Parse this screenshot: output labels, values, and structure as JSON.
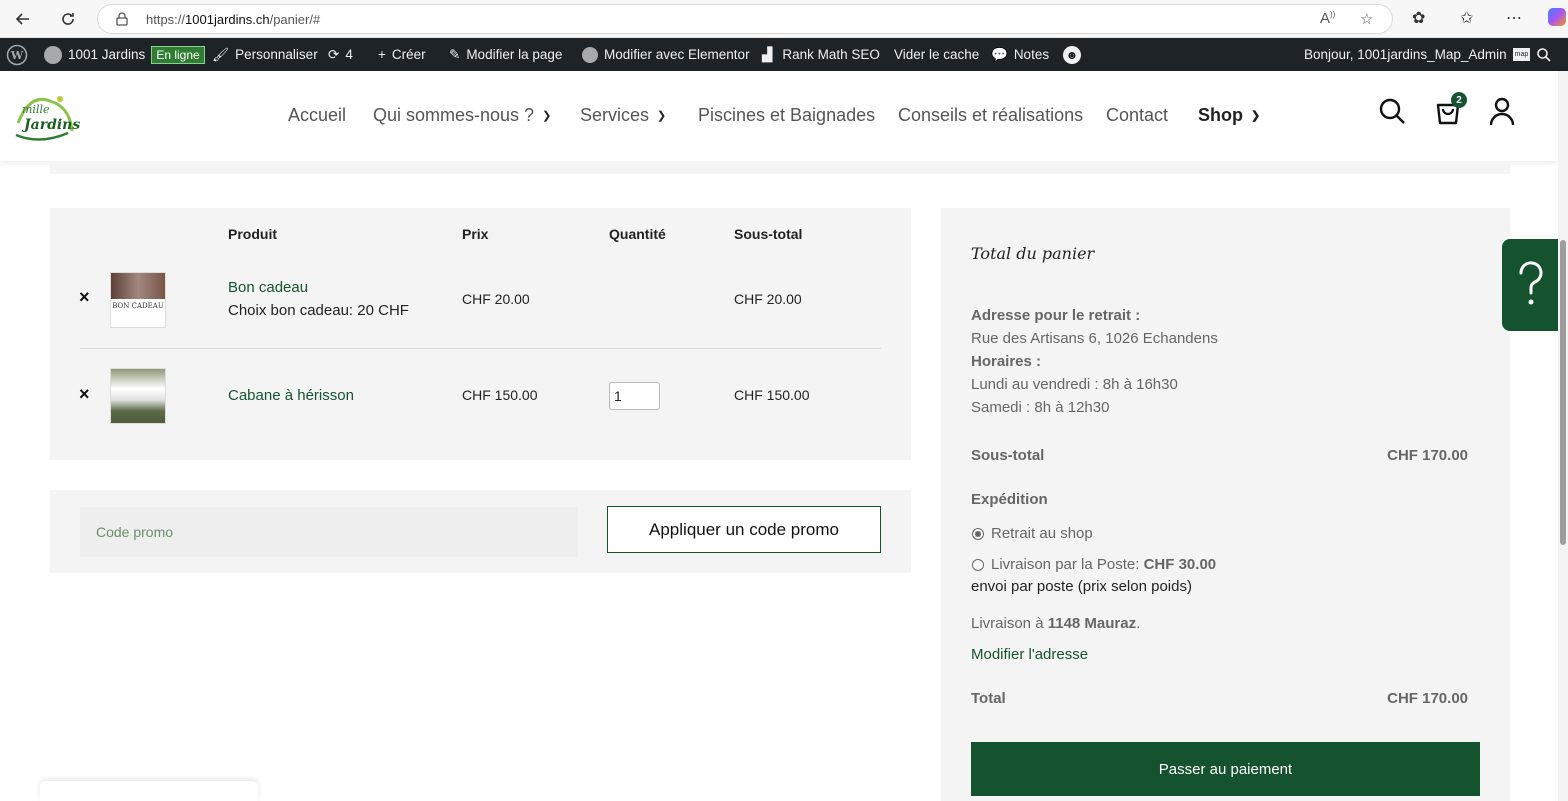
{
  "browser": {
    "url_prefix": "https://",
    "url_domain": "1001jardins.ch",
    "url_path": "/panier/#"
  },
  "wpbar": {
    "site_name": "1001 Jardins",
    "online_badge": "En ligne",
    "customize": "Personnaliser",
    "updates_count": "4",
    "create": "Créer",
    "edit_page": "Modifier la page",
    "edit_elementor": "Modifier avec Elementor",
    "rank_math": "Rank Math SEO",
    "clear_cache": "Vider le cache",
    "notes": "Notes",
    "greeting": "Bonjour, 1001jardins_Map_Admin",
    "avatar_text": "map"
  },
  "nav": {
    "items": [
      {
        "label": "Accueil"
      },
      {
        "label": "Qui sommes-nous ?"
      },
      {
        "label": "Services"
      },
      {
        "label": "Piscines et Baignades"
      },
      {
        "label": "Conseils et réalisations"
      },
      {
        "label": "Contact"
      },
      {
        "label": "Shop"
      }
    ],
    "cart_count": "2"
  },
  "cart": {
    "headers": {
      "product": "Produit",
      "price": "Prix",
      "quantity": "Quantité",
      "subtotal": "Sous-total"
    },
    "rows": [
      {
        "remove": "×",
        "name": "Bon cadeau",
        "meta": "Choix bon cadeau: 20 CHF",
        "price": "CHF 20.00",
        "subtotal": "CHF 20.00",
        "thumb_text": "BON CADEAU"
      },
      {
        "remove": "×",
        "name": "Cabane à hérisson",
        "price": "CHF 150.00",
        "quantity": "1",
        "subtotal": "CHF 150.00"
      }
    ]
  },
  "coupon": {
    "placeholder": "Code promo",
    "button": "Appliquer un code promo"
  },
  "totals": {
    "title": "Total du panier",
    "pickup_label": "Adresse pour le retrait :",
    "pickup_address": "Rue des Artisans 6, 1026 Echandens",
    "hours_label": "Horaires :",
    "hours_weekdays": "Lundi au vendredi : 8h à 16h30",
    "hours_saturday": "Samedi : 8h à 12h30",
    "subtotal_label": "Sous-total",
    "subtotal_value": "CHF 170.00",
    "shipping_label": "Expédition",
    "option_pickup": "Retrait au shop",
    "option_post": "Livraison par la Poste:",
    "option_post_price": "CHF 30.00",
    "option_post_note": "envoi par poste (prix selon poids)",
    "delivery_prefix": "Livraison à",
    "delivery_place": "1148 Mauraz",
    "change_address": "Modifier l'adresse",
    "total_label": "Total",
    "total_value": "CHF 170.00",
    "checkout": "Passer au paiement"
  },
  "colors": {
    "brand_green": "#14532d",
    "admin_bar": "#1d2327"
  }
}
